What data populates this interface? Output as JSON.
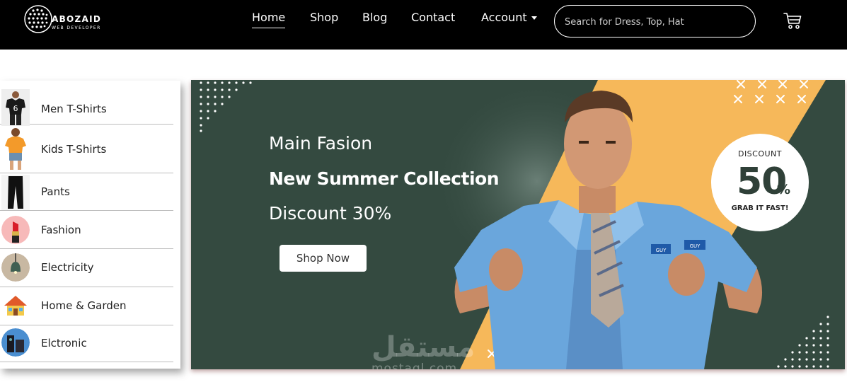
{
  "brand": {
    "title": "ABOZAID",
    "subtitle": "WEB DEVELOPER"
  },
  "nav": {
    "items": [
      {
        "label": "Home",
        "active": true
      },
      {
        "label": "Shop"
      },
      {
        "label": "Blog"
      },
      {
        "label": "Contact"
      },
      {
        "label": "Account",
        "has_dropdown": true
      }
    ]
  },
  "search": {
    "placeholder": "Search for Dress, Top, Hat",
    "value": ""
  },
  "cart": {
    "icon": "cart-icon"
  },
  "categories": [
    {
      "label": "Men T-Shirts",
      "icon": "men-tshirt-icon"
    },
    {
      "label": "Kids T-Shirts",
      "icon": "kids-tshirt-icon"
    },
    {
      "label": "Pants",
      "icon": "pants-icon"
    },
    {
      "label": "Fashion",
      "icon": "lipstick-icon"
    },
    {
      "label": "Electricity",
      "icon": "lamp-icon"
    },
    {
      "label": "Home & Garden",
      "icon": "house-icon"
    },
    {
      "label": "Elctronic",
      "icon": "electronic-icon"
    }
  ],
  "banner": {
    "line1": "Main Fasion",
    "line2": "New Summer Collection",
    "line3": "Discount 30%",
    "button": "Shop Now",
    "badge": {
      "top": "DISCOUNT",
      "number": "50",
      "percent": "%",
      "bottom": "GRAB IT FAST!"
    },
    "tag_text": "GUY",
    "watermark_ar": "مستقل",
    "watermark_en": "mostaql.com"
  },
  "colors": {
    "header": "#000000",
    "banner_bg": "#344a40",
    "accent_stripe": "#f6b85a",
    "badge_text": "#2f4038",
    "shirt": "#6aa6dc"
  }
}
